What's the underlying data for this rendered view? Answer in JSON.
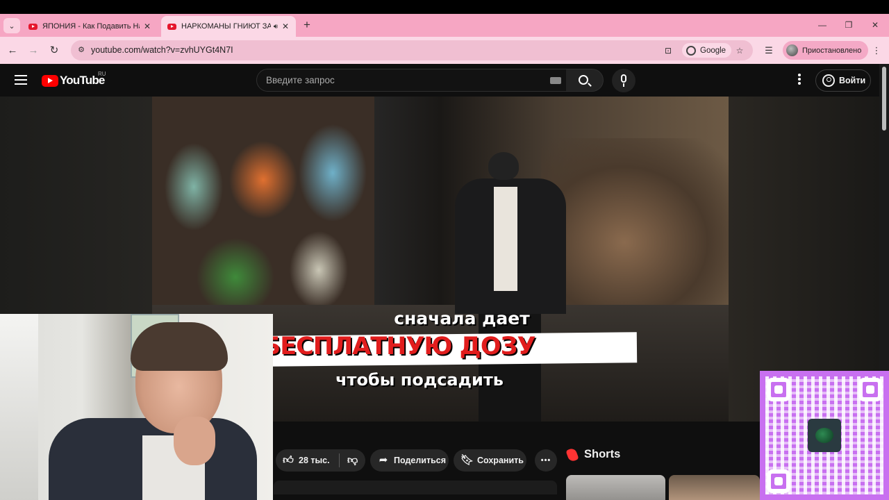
{
  "browser": {
    "tabs": [
      {
        "title": "ЯПОНИЯ - Как Подавить Нац",
        "active": false
      },
      {
        "title": "НАРКОМАНЫ ГНИЮТ ЗАЖ",
        "active": true
      }
    ],
    "url": "youtube.com/watch?v=zvhUYGt4N7I",
    "search_engine_chip": "Google",
    "profile_label": "Приостановлено"
  },
  "youtube": {
    "logo_text": "YouTube",
    "region": "RU",
    "search_placeholder": "Введите запрос",
    "signin_label": "Войти",
    "video": {
      "captions": [
        "сначала дает",
        "БЕСПЛАТНУЮ ДОЗУ",
        "чтобы подсадить"
      ]
    },
    "actions": {
      "likes": "28 тыс.",
      "share_label": "Поделиться",
      "save_label": "Сохранить",
      "more_label": "•••"
    },
    "shorts_title": "Shorts"
  },
  "colors": {
    "tabstrip": "#f6a6c3",
    "toolbar": "#fbd8e6",
    "youtube_bg": "#0f0f0f",
    "youtube_red": "#ff0000",
    "caption_red": "#e11d1d",
    "qr_purple": "#c870f0"
  },
  "icons": {
    "tab_search": "chevron-down-icon",
    "back": "arrow-left-icon",
    "forward": "arrow-right-icon",
    "reload": "reload-icon",
    "bookmark": "star-icon",
    "like": "thumbs-up-icon",
    "dislike": "thumbs-down-icon",
    "share": "share-arrow-icon",
    "save": "bookmark-icon"
  }
}
